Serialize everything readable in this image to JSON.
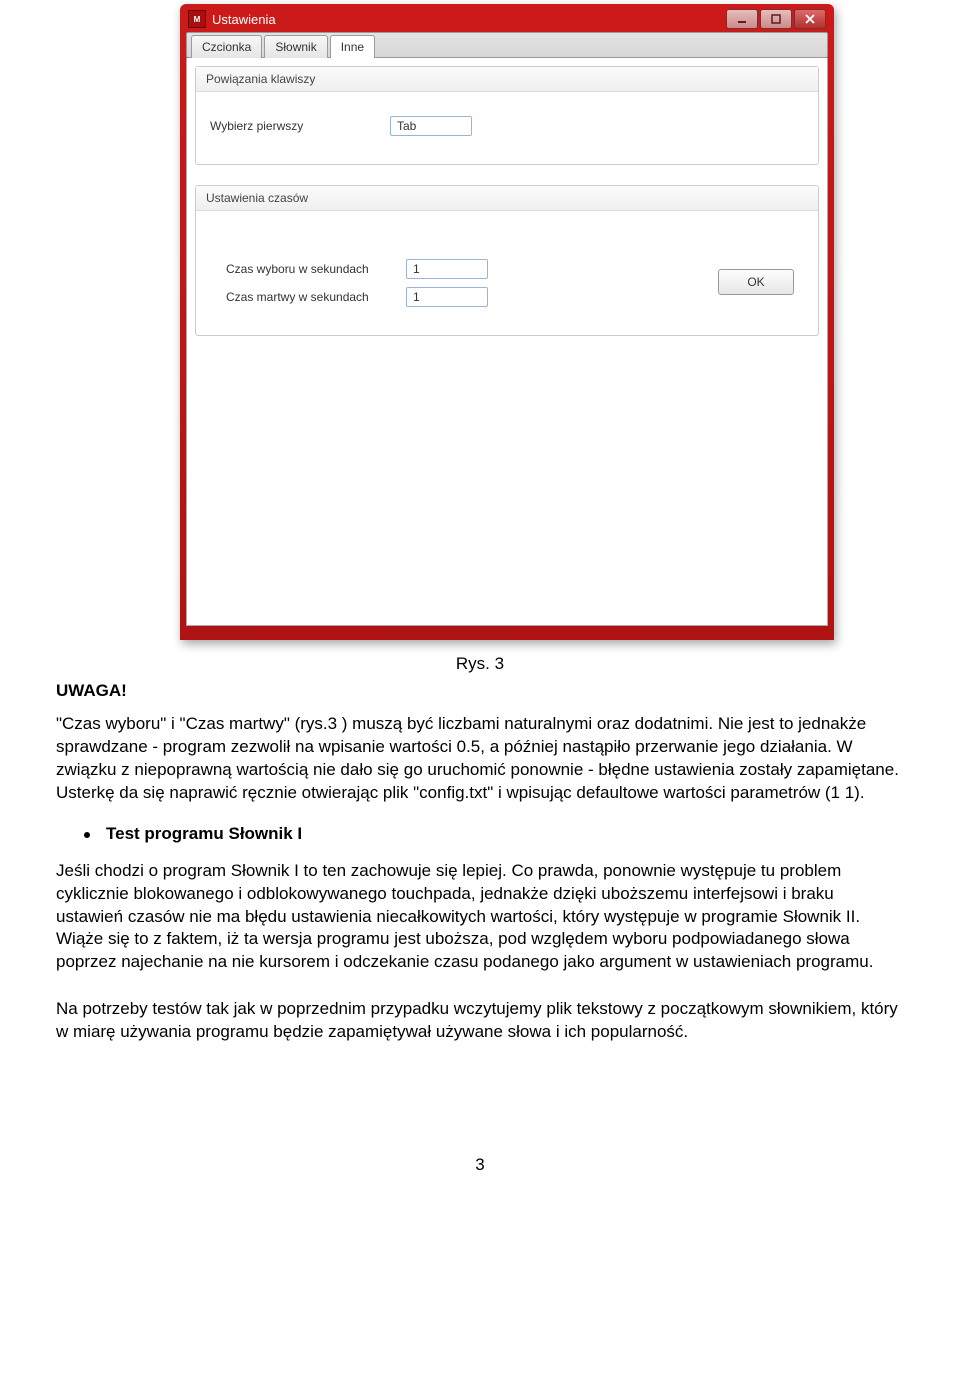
{
  "screenshot": {
    "app_icon_text": "M",
    "title": "Ustawienia",
    "tabs": {
      "czcionka": "Czcionka",
      "slownik": "Słownik",
      "inne": "Inne"
    },
    "group1": {
      "title": "Powiązania klawiszy",
      "label_wybierz": "Wybierz pierwszy",
      "value_wybierz": "Tab"
    },
    "group2": {
      "title": "Ustawienia czasów",
      "label_czas_wyboru": "Czas wyboru w sekundach",
      "value_czas_wyboru": "1",
      "label_czas_martwy": "Czas martwy w sekundach",
      "value_czas_martwy": "1",
      "ok_label": "OK"
    }
  },
  "caption": "Rys. 3",
  "heading": "UWAGA!",
  "para1": "\"Czas wyboru\" i \"Czas martwy\" (rys.3 ) muszą być liczbami naturalnymi oraz dodatnimi. Nie jest to jednakże sprawdzane - program zezwolił na wpisanie wartości 0.5, a później nastąpiło przerwanie jego działania. W związku z niepoprawną wartością nie dało się go uruchomić ponownie - błędne ustawienia zostały zapamiętane. Usterkę da się naprawić ręcznie otwierając plik \"config.txt\" i wpisując defaultowe wartości parametrów (1 1).",
  "bullet_heading": "Test programu Słownik I",
  "para2": "Jeśli chodzi o program Słownik I to ten zachowuje się lepiej. Co prawda, ponownie występuje tu problem cyklicznie blokowanego i odblokowywanego touchpada, jednakże dzięki uboższemu interfejsowi i braku ustawień czasów nie ma błędu ustawienia niecałkowitych wartości, który występuje w programie Słownik II. Wiąże się to z faktem, iż ta wersja programu jest uboższa, pod względem wyboru podpowiadanego słowa poprzez najechanie na nie kursorem i odczekanie czasu podanego jako argument w ustawieniach programu.",
  "para3": "Na potrzeby testów tak jak w poprzednim przypadku wczytujemy plik tekstowy z początkowym słownikiem, który w miarę używania programu będzie zapamiętywał używane słowa i ich popularność.",
  "page_number": "3"
}
